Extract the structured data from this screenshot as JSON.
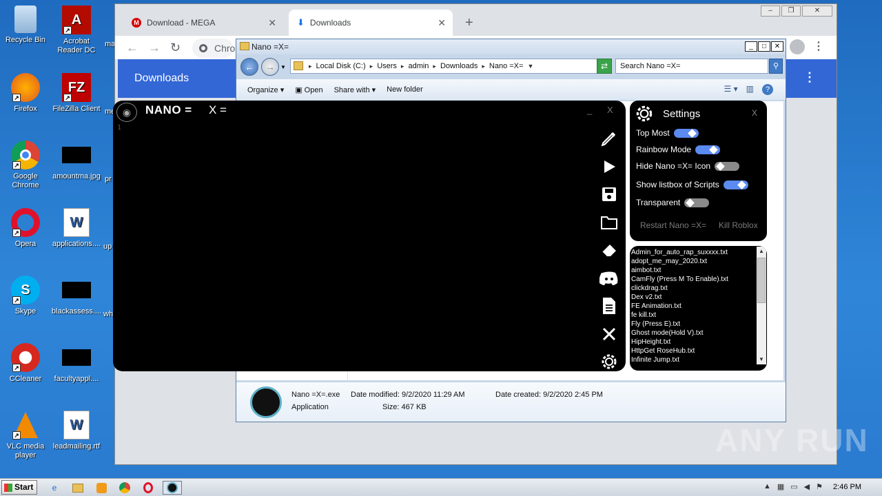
{
  "desktop_icons": [
    {
      "label": "Recycle Bin",
      "icon": "recycle-bin-icon"
    },
    {
      "label": "Acrobat Reader DC",
      "icon": "acrobat-icon"
    },
    {
      "label": "Firefox",
      "icon": "firefox-icon"
    },
    {
      "label": "FileZilla Client",
      "icon": "filezilla-icon"
    },
    {
      "label": "Google Chrome",
      "icon": "chrome-icon"
    },
    {
      "label": "amountma.jpg",
      "icon": "image-file-icon"
    },
    {
      "label": "Opera",
      "icon": "opera-icon"
    },
    {
      "label": "applications....",
      "icon": "word-file-icon"
    },
    {
      "label": "Skype",
      "icon": "skype-icon"
    },
    {
      "label": "blackassess....",
      "icon": "image-file-icon"
    },
    {
      "label": "CCleaner",
      "icon": "ccleaner-icon"
    },
    {
      "label": "facultyappl....",
      "icon": "image-file-icon"
    },
    {
      "label": "VLC media player",
      "icon": "vlc-icon"
    },
    {
      "label": "leadmailing.rtf",
      "icon": "word-file-icon"
    }
  ],
  "desktop_partial": {
    "ma": "ma",
    "me": "me",
    "pr": "pr",
    "up": "up",
    "wh": "wh"
  },
  "chrome": {
    "tabs": [
      {
        "label": "Download - MEGA",
        "icon": "mega-icon",
        "close": "✕"
      },
      {
        "label": "Downloads",
        "icon": "download-icon",
        "close": "✕"
      }
    ],
    "new_tab": "+",
    "address": "Chro",
    "page_title": "Downloads"
  },
  "explorer": {
    "title": "Nano =X=",
    "breadcrumb": [
      "Local Disk (C:)",
      "Users",
      "admin",
      "Downloads",
      "Nano =X="
    ],
    "search_placeholder": "Search Nano =X=",
    "commands": {
      "organize": "Organize",
      "open": "Open",
      "share": "Share with",
      "new_folder": "New folder"
    },
    "details": {
      "name": "Nano =X=.exe",
      "type": "Application",
      "date_modified_label": "Date modified:",
      "date_modified": "9/2/2020 11:29 AM",
      "size_label": "Size:",
      "size": "467 KB",
      "date_created_label": "Date created:",
      "date_created": "9/2/2020 2:45 PM"
    }
  },
  "nano": {
    "title": "NANO =",
    "title_suffix": "X =",
    "line_number": "1",
    "minimize": "_",
    "close": "X",
    "sidebar": [
      "edit-icon",
      "execute-icon",
      "save-icon",
      "open-folder-icon",
      "clear-icon",
      "discord-icon",
      "script-list-icon",
      "tools-icon",
      "settings-icon"
    ]
  },
  "settings": {
    "title": "Settings",
    "close": "X",
    "options": [
      {
        "label": "Top Most",
        "on": true
      },
      {
        "label": "Rainbow Mode",
        "on": true
      },
      {
        "label": "Hide Nano =X= Icon",
        "on": false
      },
      {
        "label": "Show listbox of Scripts",
        "on": true
      },
      {
        "label": "Transparent",
        "on": false
      }
    ],
    "restart": "Restart Nano =X=",
    "kill": "Kill Roblox"
  },
  "scripts": [
    "Admin_for_auto_rap_suxxxx.txt",
    "adopt_me_may_2020.txt",
    "aimbot.txt",
    "CamFly (Press M To Enable).txt",
    "clickdrag.txt",
    "Dex v2.txt",
    "FE Animation.txt",
    "fe kill.txt",
    "Fly (Press E).txt",
    "Ghost mode(Hold V).txt",
    "HipHeight.txt",
    "HttpGet RoseHub.txt",
    "Infinite Jump.txt"
  ],
  "taskbar": {
    "start": "Start",
    "clock": "2:46 PM"
  },
  "watermark": "ANY RUN"
}
